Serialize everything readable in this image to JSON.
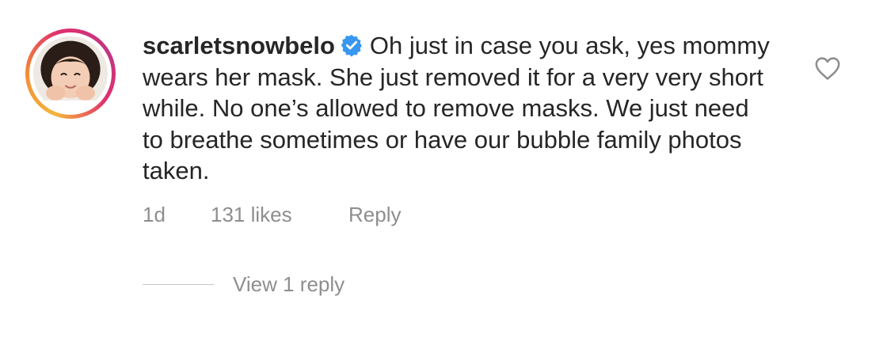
{
  "comment": {
    "username": "scarletsnowbelo",
    "verified": true,
    "text": "Oh just in case you ask, yes mommy wears her mask. She just removed it for a very very short while. No one’s allowed to remove masks. We just need to breathe sometimes or have our bubble family photos taken.",
    "time": "1d",
    "likes": "131 likes",
    "reply_label": "Reply",
    "view_replies_label": "View 1 reply",
    "icons": {
      "like": "heart-outline-icon",
      "verified": "verified-badge-icon"
    }
  },
  "colors": {
    "text": "#262626",
    "secondary": "#8e8e8e",
    "verified_blue": "#3897f0"
  }
}
